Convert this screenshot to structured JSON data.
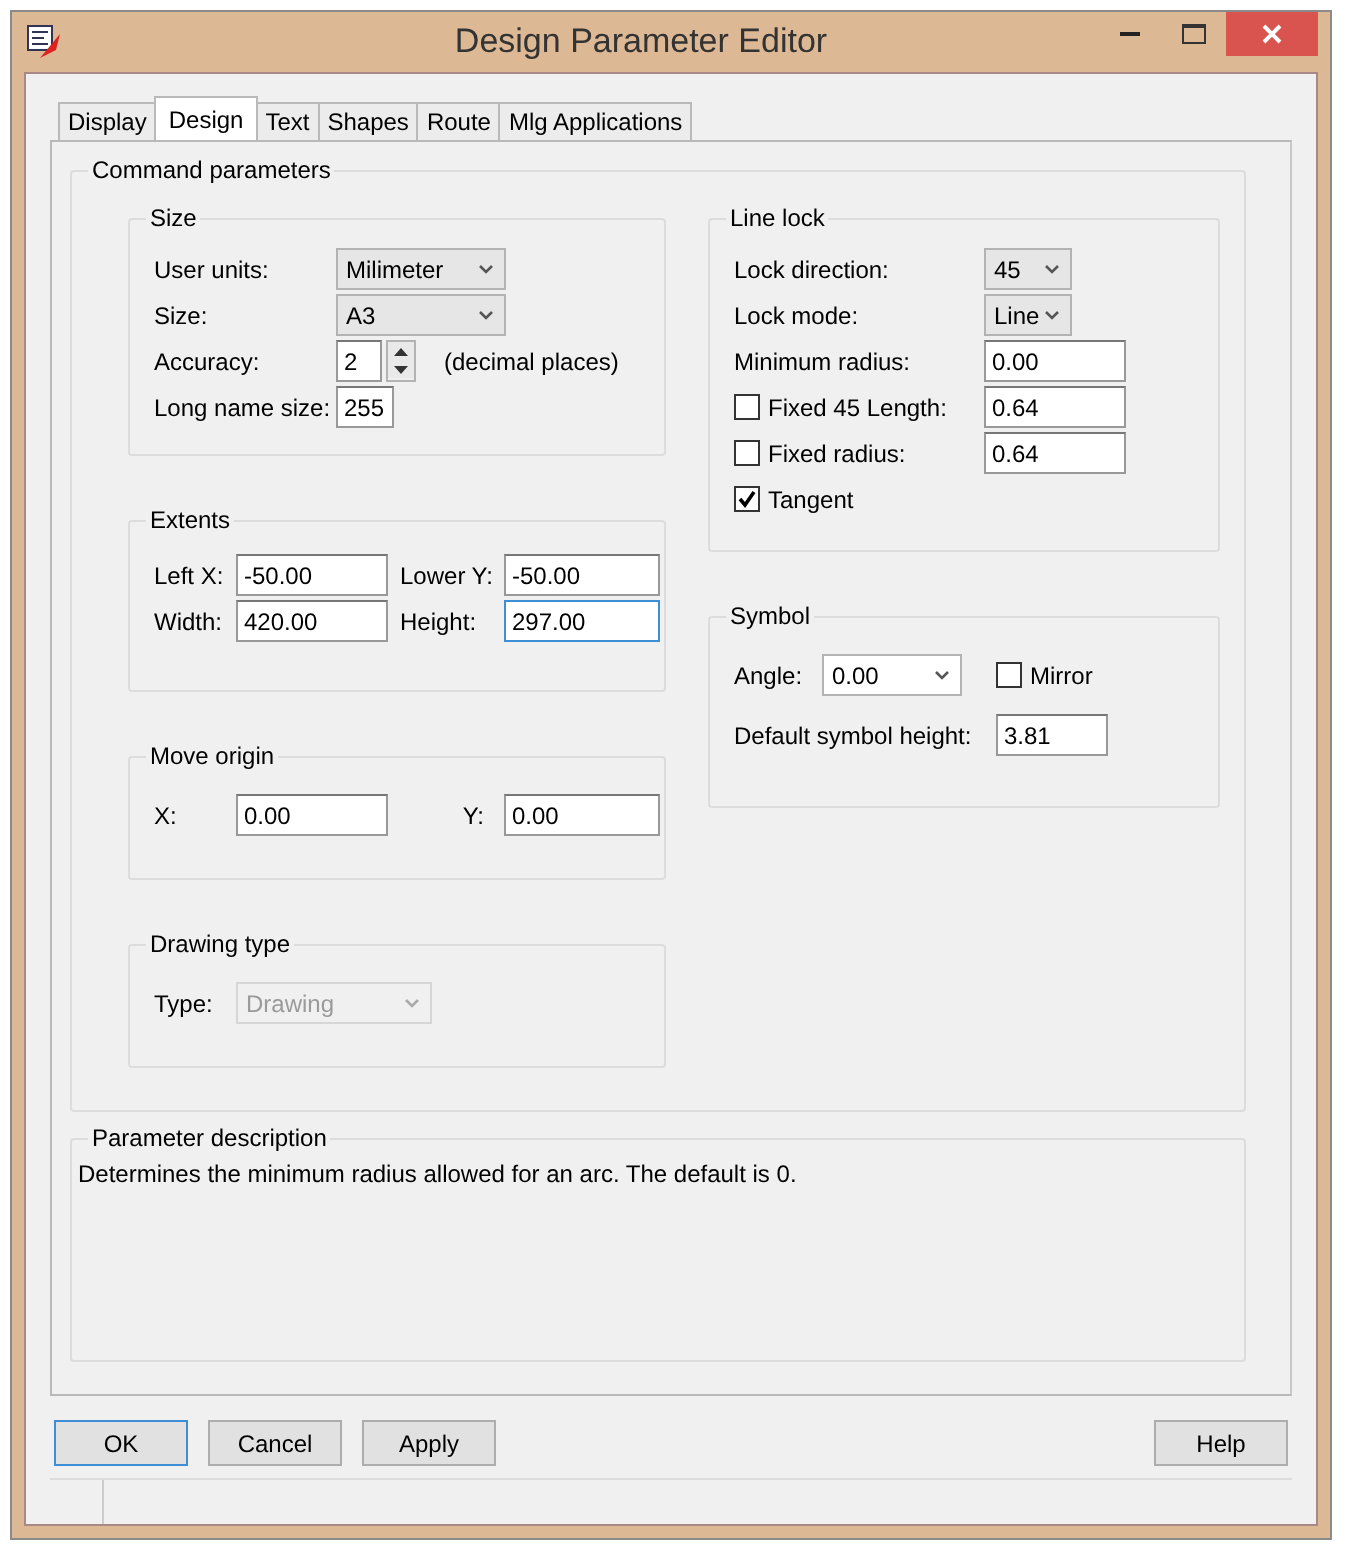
{
  "window": {
    "title": "Design Parameter Editor"
  },
  "tabs": [
    {
      "label": "Display",
      "selected": false
    },
    {
      "label": "Design",
      "selected": true
    },
    {
      "label": "Text",
      "selected": false
    },
    {
      "label": "Shapes",
      "selected": false
    },
    {
      "label": "Route",
      "selected": false
    },
    {
      "label": "Mlg Applications",
      "selected": false
    }
  ],
  "command_parameters": {
    "title": "Command parameters",
    "size": {
      "title": "Size",
      "rows": [
        {
          "kind": "dropdown",
          "label": "User units:",
          "value": "Milimeter"
        },
        {
          "kind": "dropdown",
          "label": "Size:",
          "value": "A3"
        },
        {
          "kind": "spin",
          "label": "Accuracy:",
          "value": "2",
          "note": "(decimal places)"
        },
        {
          "kind": "field",
          "label": "Long name size:",
          "value": "255"
        }
      ]
    },
    "extents": {
      "title": "Extents",
      "fields": [
        {
          "label": "Left X:",
          "value": "-50.00",
          "focused": false
        },
        {
          "label": "Lower Y:",
          "value": "-50.00",
          "focused": false
        },
        {
          "label": "Width:",
          "value": "420.00",
          "focused": false
        },
        {
          "label": "Height:",
          "value": "297.00",
          "focused": true
        }
      ]
    },
    "move_origin": {
      "title": "Move origin",
      "fields": [
        {
          "label": "X:",
          "value": "0.00"
        },
        {
          "label": "Y:",
          "value": "0.00"
        }
      ]
    },
    "drawing_type": {
      "title": "Drawing type",
      "label": "Type:",
      "value": "Drawing",
      "disabled": true
    },
    "line_lock": {
      "title": "Line lock",
      "rows": [
        {
          "kind": "dropdown",
          "label": "Lock direction:",
          "value": "45"
        },
        {
          "kind": "dropdown",
          "label": "Lock mode:",
          "value": "Line"
        },
        {
          "kind": "field",
          "label": "Minimum radius:",
          "value": "0.00"
        },
        {
          "kind": "check-field",
          "label": "Fixed 45 Length:",
          "checked": false,
          "value": "0.64"
        },
        {
          "kind": "check-field",
          "label": "Fixed radius:",
          "checked": false,
          "value": "0.64"
        },
        {
          "kind": "check",
          "label": "Tangent",
          "checked": true
        }
      ]
    },
    "symbol": {
      "title": "Symbol",
      "angle": {
        "label": "Angle:",
        "value": "0.00"
      },
      "mirror": {
        "label": "Mirror",
        "checked": false
      },
      "default_height": {
        "label": "Default symbol height:",
        "value": "3.81"
      }
    }
  },
  "parameter_description": {
    "title": "Parameter description",
    "text": "Determines the minimum radius allowed for an arc. The default is 0."
  },
  "buttons": [
    {
      "label": "OK",
      "default": true
    },
    {
      "label": "Cancel",
      "default": false
    },
    {
      "label": "Apply",
      "default": false
    }
  ],
  "help_button": {
    "label": "Help"
  }
}
